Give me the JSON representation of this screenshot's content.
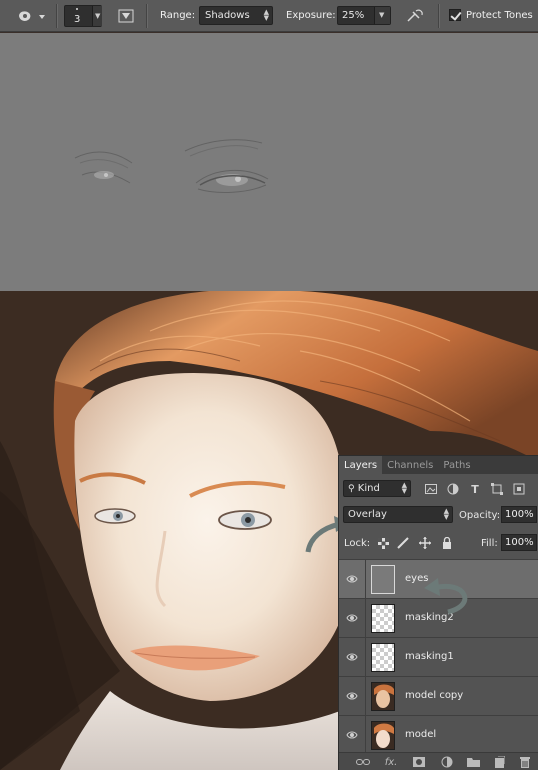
{
  "options_bar": {
    "brush_size": "3",
    "range_label": "Range:",
    "range_value": "Shadows",
    "exposure_label": "Exposure:",
    "exposure_value": "25%",
    "protect_tones_label": "Protect Tones",
    "protect_tones_checked": true
  },
  "layers_panel": {
    "tabs": [
      "Layers",
      "Channels",
      "Paths"
    ],
    "active_tab": "Layers",
    "filter_kind": "Kind",
    "blend_mode": "Overlay",
    "opacity_label": "Opacity:",
    "opacity_value": "100%",
    "lock_label": "Lock:",
    "fill_label": "Fill:",
    "fill_value": "100%",
    "layers": [
      {
        "name": "eyes",
        "thumb": "gray",
        "selected": true
      },
      {
        "name": "masking2",
        "thumb": "transparent",
        "selected": false
      },
      {
        "name": "masking1",
        "thumb": "transparent",
        "selected": false
      },
      {
        "name": "model copy",
        "thumb": "photo",
        "selected": false
      },
      {
        "name": "model",
        "thumb": "photo",
        "selected": false
      }
    ],
    "footer_icons": [
      "link-icon",
      "fx-icon",
      "mask-icon",
      "adjustment-icon",
      "folder-icon",
      "new-layer-icon",
      "trash-icon"
    ]
  },
  "colors": {
    "options_bar_bg": "#5a5a5a",
    "mask_canvas_bg": "#7c7c7c",
    "panel_bg": "#535353",
    "selected_layer_bg": "#6d6d6d",
    "hair": "#d9864e"
  }
}
